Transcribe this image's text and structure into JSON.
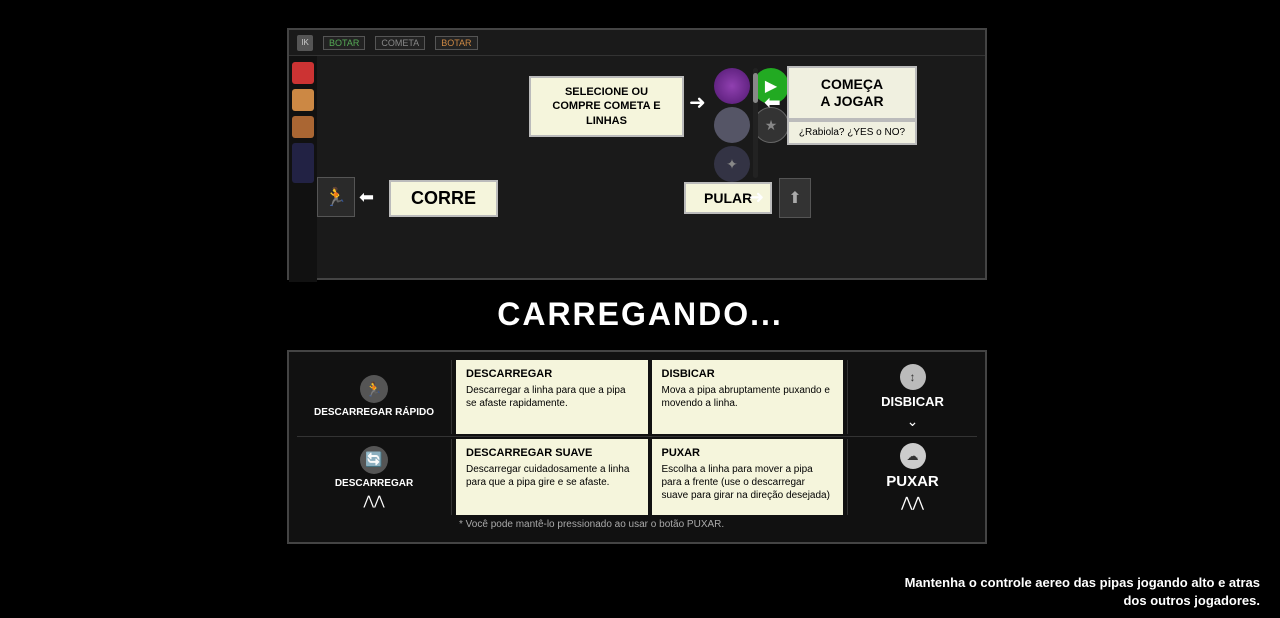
{
  "page": {
    "background": "#000000"
  },
  "topbar": {
    "buttons": [
      "IK",
      "BOTAR",
      "COMETA",
      "BOTAR"
    ]
  },
  "game_panel": {
    "cometa_label": "SELECIONE OU COMPRE\nCOMETA E LINHAS",
    "comeca_label_line1": "COMEÇA",
    "comeca_label_line2": "A JOGAR",
    "rabiola_label": "¿Rabiola? ¿YES o NO?",
    "corre_label": "CORRE",
    "pular_label": "PULAR"
  },
  "loading": {
    "text": "CARREGANDO..."
  },
  "instructions": {
    "items": [
      {
        "id": "descarregar-rapido",
        "left_label": "DESCARREGAR\nRÁPIDO",
        "title": "DESCARREGAR",
        "description": "Descarregar a linha para que a pipa se afaste rapidamente.",
        "right_title": "DISBICAR",
        "right_description": "Mova a pipa abruptamente puxando e movendo a linha.",
        "right_label": "DISBICAR"
      },
      {
        "id": "descarregar",
        "left_label": "DESCARREGAR",
        "title": "DESCARREGAR SUAVE",
        "description": "Descarregar cuidadosamente a linha para que a pipa gire e se afaste.",
        "right_title": "PUXAR",
        "right_description": "Escolha a linha para mover a pipa para a frente (use o descarregar suave para girar na direção desejada)",
        "right_label": "PUXAR"
      }
    ],
    "note": "* Você pode mantê-lo pressionado ao usar o botão PUXAR."
  },
  "footer": {
    "text_line1": "Mantenha o controle aereo das pipas jogando alto e atras",
    "text_line2": "dos outros jogadores."
  }
}
